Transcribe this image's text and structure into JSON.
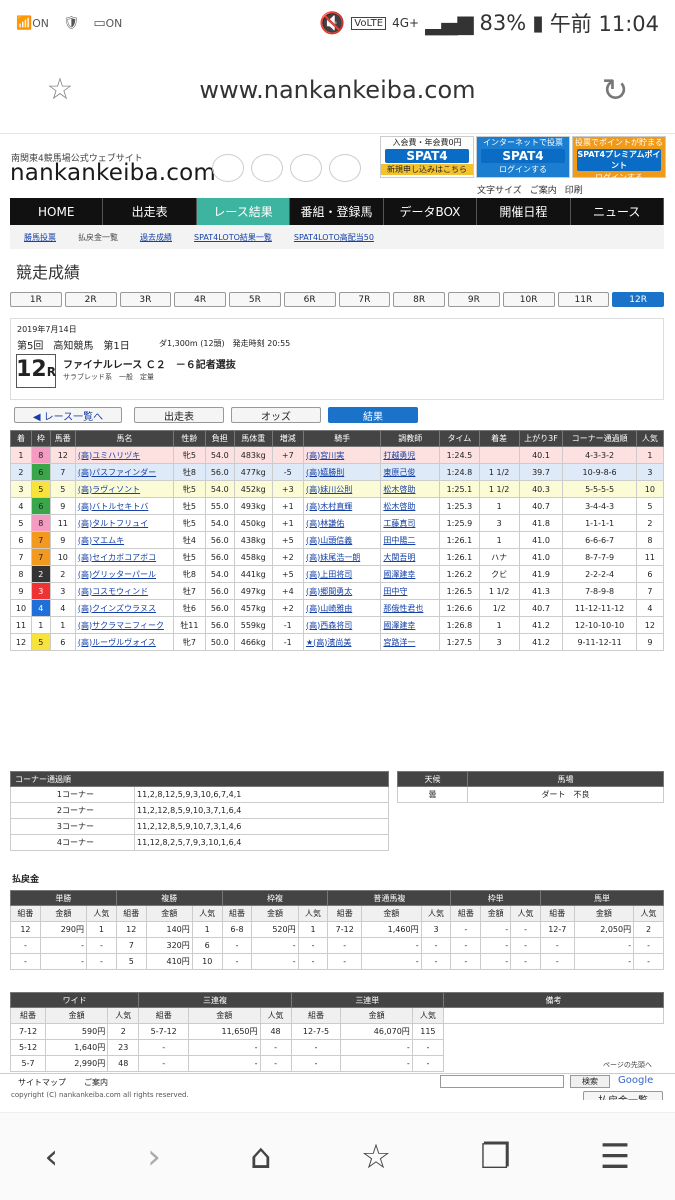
{
  "status_bar": {
    "left_labels": [
      "ON",
      "ON"
    ],
    "carrier": "VoLTE",
    "network": "4G+",
    "battery": "83%",
    "time": "午前 11:04"
  },
  "address_bar": {
    "url": "www.nankankeiba.com"
  },
  "header": {
    "tagline": "南関東4競馬場公式ウェブサイト",
    "logo": "nankankeiba.com",
    "spat": [
      {
        "title": "入会費・年会費0円",
        "brand": "SPAT4",
        "sub": "新規申し込みはこちら"
      },
      {
        "title": "インターネットで投票",
        "brand": "SPAT4",
        "sub": "ログインする"
      },
      {
        "title": "投票でポイントが貯まる",
        "brand": "SPAT4プレミアムポイント",
        "sub": "ログインする"
      }
    ],
    "tools": [
      "文字サイズ",
      "ご案内",
      "印刷"
    ]
  },
  "global_nav": [
    "HOME",
    "出走表",
    "レース結果",
    "番組・登録馬",
    "データBOX",
    "開催日程",
    "ニュース"
  ],
  "sub_nav": [
    "勝馬投票",
    "払戻金一覧",
    "過去成績",
    "SPAT4LOTO結果一覧",
    "SPAT4LOTO高配当50"
  ],
  "page_title": "競走成績",
  "race_tabs": [
    "1R",
    "2R",
    "3R",
    "4R",
    "5R",
    "6R",
    "7R",
    "8R",
    "9R",
    "10R",
    "11R",
    "12R"
  ],
  "race_info": {
    "date": "2019年7月14日",
    "meeting": "第5回　高知競馬　第1日",
    "course": "ダ1,300m (12頭)　発走時刻 20:55",
    "race_no": "12",
    "race_suffix": "R",
    "race_name": "ファイナルレース Ｃ２　－６記者選抜",
    "conditions": "サラブレッド系　一般　定量"
  },
  "buttons": [
    "◀ レース一覧へ",
    "出走表",
    "オッズ",
    "結果"
  ],
  "result_headers": [
    "着",
    "枠",
    "馬番",
    "馬名",
    "性齢",
    "負担",
    "馬体重",
    "増減",
    "騎手",
    "調教師",
    "タイム",
    "着差",
    "上がり3F",
    "コーナー通過順",
    "人気"
  ],
  "results": [
    [
      "1",
      "8",
      "12",
      "(高)ユミハリヅキ",
      "牝5",
      "54.0",
      "483kg",
      "+7",
      "(高)宮川実",
      "打越勇児",
      "1:24.5",
      "",
      "40.1",
      "4-3-3-2",
      "1"
    ],
    [
      "2",
      "6",
      "7",
      "(高)パスファインダー",
      "牡8",
      "56.0",
      "477kg",
      "-5",
      "(高)嬉勝則",
      "東原己俊",
      "1:24.8",
      "1 1/2",
      "39.7",
      "10-9-8-6",
      "3"
    ],
    [
      "3",
      "5",
      "5",
      "(高)ラヴィソント",
      "牝5",
      "54.0",
      "452kg",
      "+3",
      "(高)妹川公則",
      "松木啓助",
      "1:25.1",
      "1 1/2",
      "40.3",
      "5-5-5-5",
      "10"
    ],
    [
      "4",
      "6",
      "9",
      "(高)バトルセキトバ",
      "牡5",
      "55.0",
      "493kg",
      "+1",
      "(高)木村直輝",
      "松木啓助",
      "1:25.3",
      "1",
      "40.7",
      "3-4-4-3",
      "5"
    ],
    [
      "5",
      "8",
      "11",
      "(高)タルトフリュイ",
      "牝5",
      "54.0",
      "450kg",
      "+1",
      "(高)林謙佑",
      "工藤真司",
      "1:25.9",
      "3",
      "41.8",
      "1-1-1-1",
      "2"
    ],
    [
      "6",
      "7",
      "9",
      "(高)マエムキ",
      "牡4",
      "56.0",
      "438kg",
      "+5",
      "(高)山頭信義",
      "田中陽二",
      "1:26.1",
      "1",
      "41.0",
      "6-6-6-7",
      "8"
    ],
    [
      "7",
      "7",
      "10",
      "(高)セイカボコアボコ",
      "牡5",
      "56.0",
      "458kg",
      "+2",
      "(高)妹尾浩一朗",
      "大関吾明",
      "1:26.1",
      "ハナ",
      "41.0",
      "8-7-7-9",
      "11"
    ],
    [
      "8",
      "2",
      "2",
      "(高)グリッターパール",
      "牝8",
      "54.0",
      "441kg",
      "+5",
      "(高)上田将司",
      "國澤建幸",
      "1:26.2",
      "クビ",
      "41.9",
      "2-2-2-4",
      "6"
    ],
    [
      "9",
      "3",
      "3",
      "(高)コスモウィンド",
      "牡7",
      "56.0",
      "497kg",
      "+4",
      "(高)郷間勇太",
      "田中守",
      "1:26.5",
      "1 1/2",
      "41.3",
      "7-8-9-8",
      "7"
    ],
    [
      "10",
      "4",
      "4",
      "(高)クインズウラヌス",
      "牡6",
      "56.0",
      "457kg",
      "+2",
      "(高)山崎雅由",
      "那俄性君也",
      "1:26.6",
      "1/2",
      "40.7",
      "11-12-11-12",
      "4"
    ],
    [
      "11",
      "1",
      "1",
      "(高)サクラマニフィーク",
      "牡11",
      "56.0",
      "559kg",
      "-1",
      "(高)西森将司",
      "國澤建幸",
      "1:26.8",
      "1",
      "41.2",
      "12-10-10-10",
      "12"
    ],
    [
      "12",
      "5",
      "6",
      "(高)ルーヴルヴォイス",
      "牝7",
      "50.0",
      "466kg",
      "-1",
      "★(高)濱尚美",
      "宮路洋一",
      "1:27.5",
      "3",
      "41.2",
      "9-11-12-11",
      "9"
    ]
  ],
  "corner": {
    "title": "コーナー通過順",
    "rows": [
      [
        "1コーナー",
        "11,2,8,12,5,9,3,10,6,7,4,1"
      ],
      [
        "2コーナー",
        "11,2,12,8,5,9,10,3,7,1,6,4"
      ],
      [
        "3コーナー",
        "11,2,12,8,5,9,10,7,3,1,4,6"
      ],
      [
        "4コーナー",
        "11,12,8,2,5,7,9,3,10,1,6,4"
      ]
    ]
  },
  "weather": {
    "headers": [
      "天候",
      "馬場"
    ],
    "values": [
      "曇",
      "ダート　不良"
    ]
  },
  "payout_title": "払戻金",
  "payout1": {
    "groups": [
      "単勝",
      "複勝",
      "枠複",
      "普通馬複",
      "枠単",
      "馬単"
    ],
    "sub": [
      "組番",
      "金額",
      "人気"
    ],
    "rows": [
      [
        "12",
        "290円",
        "1",
        "12",
        "140円",
        "1",
        "6-8",
        "520円",
        "1",
        "7-12",
        "1,460円",
        "3",
        "-",
        "-",
        "-",
        "12-7",
        "2,050円",
        "2"
      ],
      [
        "-",
        "-",
        "-",
        "7",
        "320円",
        "6",
        "-",
        "-",
        "-",
        "-",
        "-",
        "-",
        "-",
        "-",
        "-",
        "-",
        "-",
        "-"
      ],
      [
        "-",
        "-",
        "-",
        "5",
        "410円",
        "10",
        "-",
        "-",
        "-",
        "-",
        "-",
        "-",
        "-",
        "-",
        "-",
        "-",
        "-",
        "-"
      ]
    ]
  },
  "payout2": {
    "groups": [
      "ワイド",
      "三連複",
      "三連単",
      "備考"
    ],
    "sub": [
      "組番",
      "金額",
      "人気"
    ],
    "rows": [
      [
        "7-12",
        "590円",
        "2",
        "5-7-12",
        "11,650円",
        "48",
        "12-7-5",
        "46,070円",
        "115"
      ],
      [
        "5-12",
        "1,640円",
        "23",
        "-",
        "-",
        "-",
        "-",
        "-",
        "-"
      ],
      [
        "5-7",
        "2,990円",
        "48",
        "-",
        "-",
        "-",
        "-",
        "-",
        "-"
      ]
    ]
  },
  "payout_list_button": "払戻金一覧",
  "page_top": "ページの先頭へ",
  "footer": {
    "links": [
      "サイトマップ",
      "ご案内"
    ],
    "copyright": "copyright (C) nankankeiba.com all rights reserved.",
    "search_button": "検索",
    "google": "Google"
  },
  "waku_colors": {
    "1": "#ffffff",
    "2": "#333333",
    "3": "#e33",
    "4": "#1e6fd9",
    "5": "#f7e33b",
    "6": "#3aa64a",
    "7": "#f39a1e",
    "8": "#f59ac0"
  },
  "row_highlights": {
    "1": "#fde0e0",
    "2": "#dfeaf8",
    "3": "#fbfbd6"
  }
}
